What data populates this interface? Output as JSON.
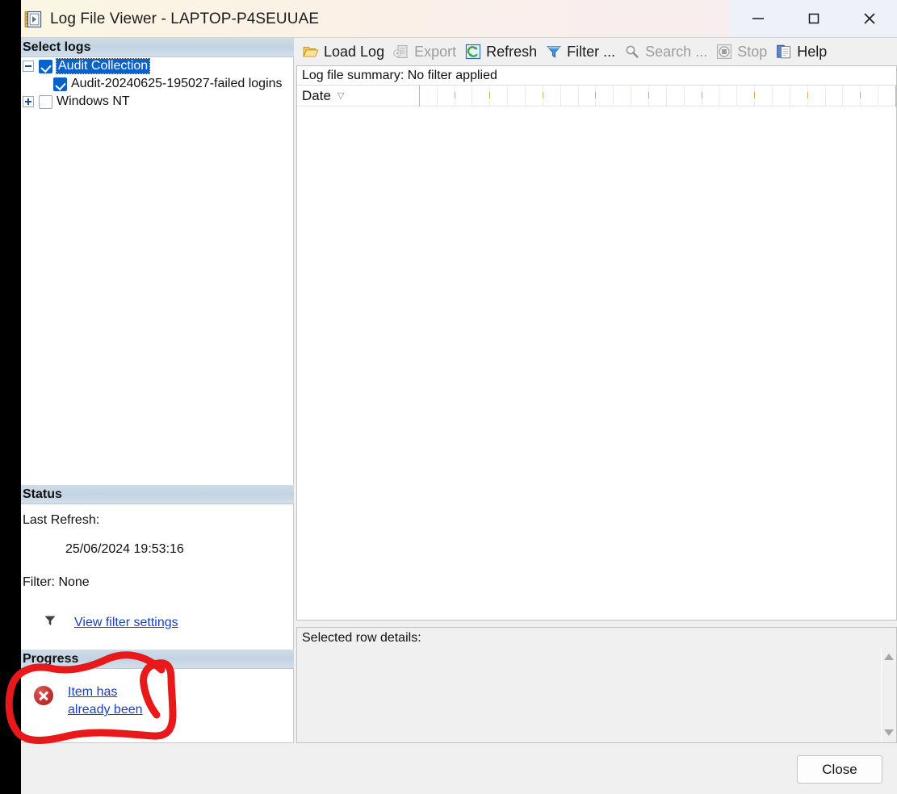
{
  "window": {
    "title": "Log File Viewer - LAPTOP-P4SEUUAE",
    "app_icon": "log-book-icon",
    "minimize_label": "Minimize",
    "maximize_label": "Maximize",
    "close_label": "Close"
  },
  "sidebar": {
    "select_logs_header": "Select logs",
    "tree": [
      {
        "label": "Audit Collection",
        "checked": true,
        "expander": "minus",
        "selected": true,
        "indent": false
      },
      {
        "label": "Audit-20240625-195027-failed logins",
        "checked": true,
        "expander": "none",
        "selected": false,
        "indent": true
      },
      {
        "label": "Windows NT",
        "checked": false,
        "expander": "plus",
        "selected": false,
        "indent": false
      }
    ],
    "status_header": "Status",
    "last_refresh_label": "Last Refresh:",
    "last_refresh_value": "25/06/2024 19:53:16",
    "filter_label": "Filter: None",
    "view_filter_settings": "View filter settings",
    "filter_icon": "funnel-icon",
    "progress_header": "Progress",
    "progress_error_icon": "error-circle-icon",
    "progress_error_line1": "Item has ",
    "progress_error_line2": "already been "
  },
  "toolbar": {
    "items": [
      {
        "label": "Load Log",
        "icon": "open-folder-icon",
        "disabled": false
      },
      {
        "label": "Export",
        "icon": "export-icon",
        "disabled": true
      },
      {
        "label": "Refresh",
        "icon": "refresh-icon",
        "disabled": false
      },
      {
        "label": "Filter ...",
        "icon": "funnel-icon",
        "disabled": false
      },
      {
        "label": "Search ...",
        "icon": "magnifier-icon",
        "disabled": true
      },
      {
        "label": "Stop",
        "icon": "stop-icon",
        "disabled": true
      },
      {
        "label": "Help",
        "icon": "help-pages-icon",
        "disabled": false
      }
    ]
  },
  "grid": {
    "summary": "Log file summary: No filter applied",
    "date_column": "Date",
    "sort_glyph": "▽",
    "rows": []
  },
  "details": {
    "label": "Selected row details:",
    "scroll_up": "scroll-up",
    "scroll_down": "scroll-down"
  },
  "footer": {
    "close_button": "Close"
  },
  "annotation": {
    "color": "#e8191b",
    "shape": "hand-drawn-circle-around-progress-error"
  },
  "colors": {
    "accent_blue": "#0a62c8",
    "link_blue": "#1a40c4",
    "section_header": "#c3d3e2",
    "annotation_red": "#e8191b",
    "error_red": "#c0302e"
  }
}
